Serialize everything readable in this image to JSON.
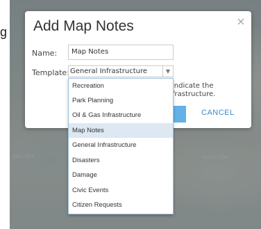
{
  "background": {
    "sea_label_left": "elan Sea",
    "sea_label_right": "aufort Sea",
    "stray_text": "g"
  },
  "dialog": {
    "title": "Add Map Notes",
    "name_label": "Name:",
    "name_value": "Map Notes",
    "template_label": "Template:",
    "template_selected": "General Infrastructure",
    "hint_line1": "indicate the",
    "hint_line2": "frastructure.",
    "cancel_label": "CANCEL"
  },
  "dropdown": {
    "items": [
      "Recreation",
      "Park Planning",
      "Oil & Gas Infrastructure",
      "Map Notes",
      "General Infrastructure",
      "Disasters",
      "Damage",
      "Civic Events",
      "Citizen Requests"
    ],
    "highlighted": "Map Notes"
  },
  "colors": {
    "accent": "#63b1e6",
    "link": "#3a89c9",
    "highlight": "#dde8f3"
  }
}
